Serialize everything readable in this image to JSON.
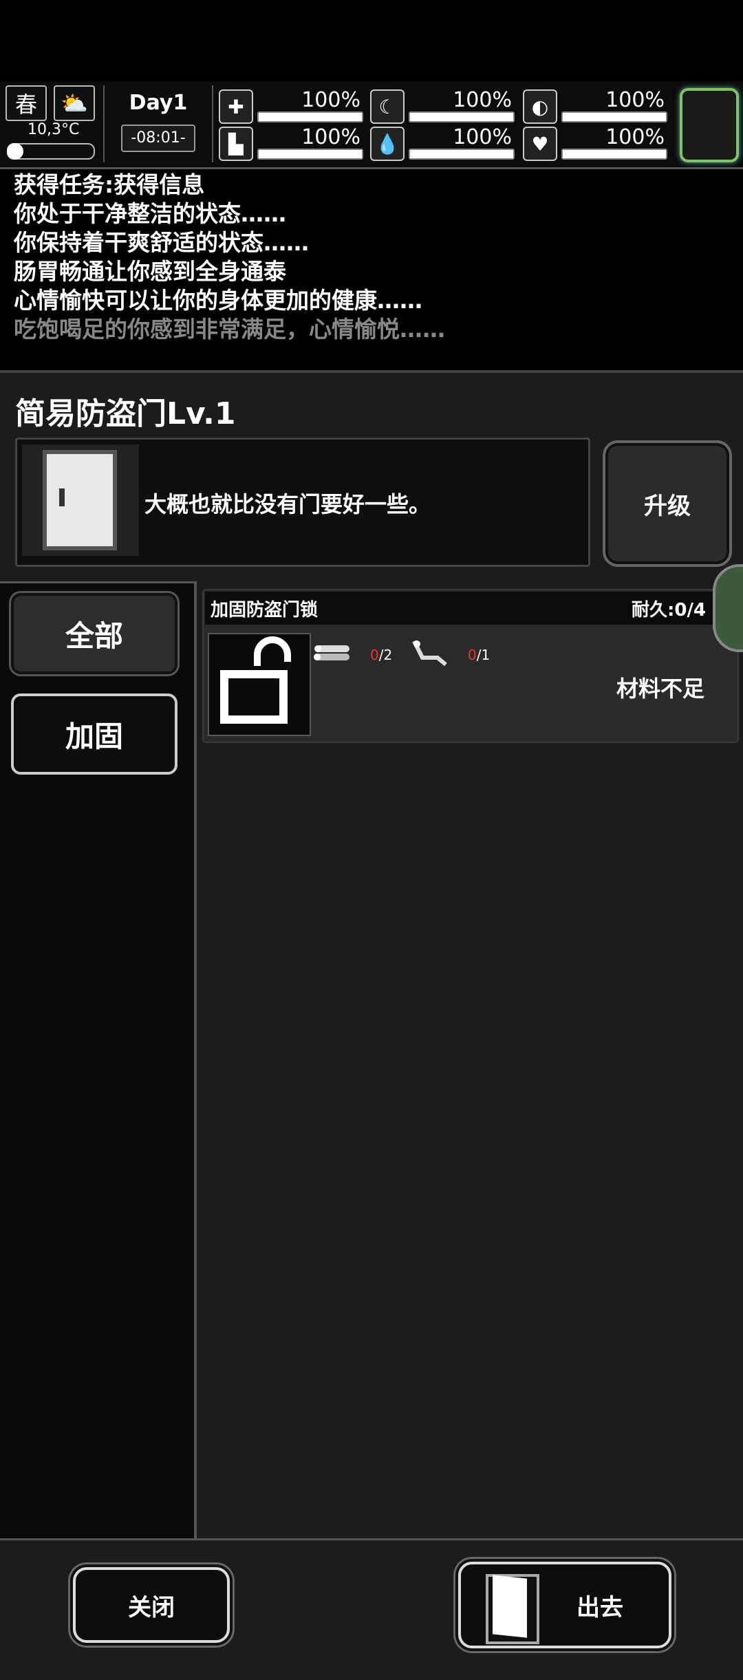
{
  "status": {
    "season": "春",
    "temperature": "10,3°C",
    "day": "Day1",
    "time": "-08:01-",
    "stats": [
      {
        "icon": "medkit-icon",
        "value": "100%",
        "level": 1.0
      },
      {
        "icon": "stomach-icon",
        "value": "100%",
        "level": 1.0
      },
      {
        "icon": "capsule-icon",
        "value": "100%",
        "level": 1.0
      },
      {
        "icon": "boot-icon",
        "value": "100%",
        "level": 1.0
      },
      {
        "icon": "water-drop-icon",
        "value": "100%",
        "level": 1.0
      },
      {
        "icon": "heart-icon",
        "value": "100%",
        "level": 1.0
      }
    ]
  },
  "log": [
    "获得任务:获得信息",
    "你处于干净整洁的状态……",
    "你保持着干爽舒适的状态……",
    "肠胃畅通让你感到全身通泰",
    "心情愉快可以让你的身体更加的健康……",
    "吃饱喝足的你感到非常满足，心情愉悦……"
  ],
  "building": {
    "title": "简易防盗门Lv.1",
    "description": "大概也就比没有门要好一些。",
    "upgrade_label": "升级"
  },
  "tabs": {
    "all": "全部",
    "reinforce": "加固"
  },
  "item": {
    "name": "加固防盗门锁",
    "durability": "耐久:0/4",
    "materials": [
      {
        "icon": "wood-logs-icon",
        "have": "0",
        "need": "/2"
      },
      {
        "icon": "pipe-parts-icon",
        "have": "0",
        "need": "/1"
      }
    ],
    "status": "材料不足"
  },
  "buttons": {
    "close": "关闭",
    "exit": "出去"
  }
}
